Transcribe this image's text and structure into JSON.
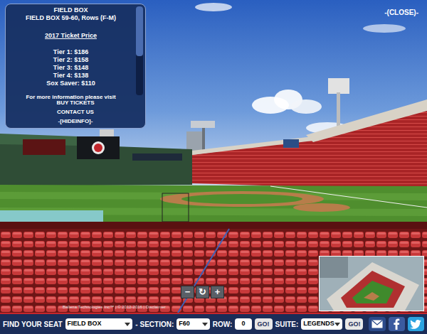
{
  "info_panel": {
    "title": "FIELD BOX",
    "subtitle": "FIELD BOX 59-60, Rows (F-M)",
    "price_heading": "2017 Ticket Price",
    "prices": [
      "Tier 1: $186",
      "Tier 2: $158",
      "Tier 3: $148",
      "Tier 4: $138",
      "Sox Saver: $110"
    ],
    "more": "For more information please visit",
    "links": [
      "BUY TICKETS",
      "CONTACT US",
      "-[HIDEINFO]-"
    ]
  },
  "close": "-(CLOSE)-",
  "zoom_controls": [
    "−",
    "↻",
    "+"
  ],
  "credits": "Ballena Technologies Inc™ | © 2012-2016 | Disclaimer",
  "seat_finder": {
    "label": "FIND YOUR SEAT",
    "section_type": "FIELD BOX",
    "section_label": "- SECTION:",
    "section": "F60",
    "row_label": "ROW:",
    "row": "0",
    "row_go": "GO!",
    "suite_label": "SUITE:",
    "suite": "LEGENDS",
    "suite_go": "GO!"
  }
}
